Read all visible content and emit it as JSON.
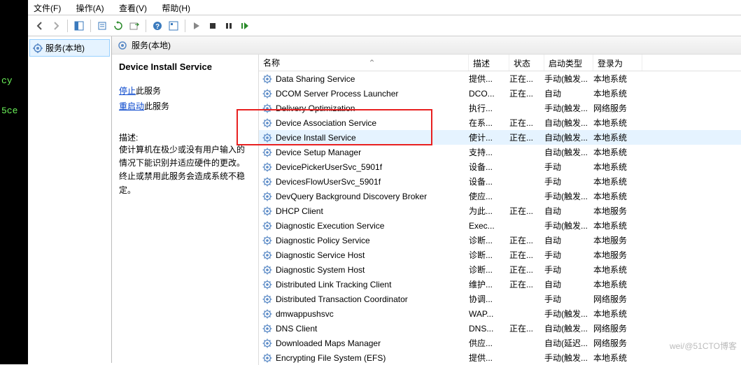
{
  "console": {
    "line1": "cy",
    "line2": "5ce"
  },
  "menu": {
    "file": "文件(F)",
    "action": "操作(A)",
    "view": "查看(V)",
    "help": "帮助(H)"
  },
  "tree": {
    "root": "服务(本地)"
  },
  "header": {
    "title": "服务(本地)"
  },
  "detail": {
    "service_name": "Device Install Service",
    "stop_link": "停止",
    "stop_suffix": "此服务",
    "restart_link": "重启动",
    "restart_suffix": "此服务",
    "desc_label": "描述:",
    "desc_text": "使计算机在极少或没有用户输入的情况下能识别并适应硬件的更改。终止或禁用此服务会造成系统不稳定。"
  },
  "columns": {
    "name": "名称",
    "desc": "描述",
    "status": "状态",
    "start": "启动类型",
    "logon": "登录为"
  },
  "rows": [
    {
      "name": "Data Sharing Service",
      "desc": "提供...",
      "status": "正在...",
      "start": "手动(触发...",
      "logon": "本地系统"
    },
    {
      "name": "DCOM Server Process Launcher",
      "desc": "DCO...",
      "status": "正在...",
      "start": "自动",
      "logon": "本地系统"
    },
    {
      "name": "Delivery Optimization",
      "desc": "执行...",
      "status": "",
      "start": "手动(触发...",
      "logon": "网络服务"
    },
    {
      "name": "Device Association Service",
      "desc": "在系...",
      "status": "正在...",
      "start": "自动(触发...",
      "logon": "本地系统"
    },
    {
      "name": "Device Install Service",
      "desc": "使计...",
      "status": "正在...",
      "start": "自动(触发...",
      "logon": "本地系统",
      "selected": true
    },
    {
      "name": "Device Setup Manager",
      "desc": "支持...",
      "status": "",
      "start": "自动(触发...",
      "logon": "本地系统"
    },
    {
      "name": "DevicePickerUserSvc_5901f",
      "desc": "设备...",
      "status": "",
      "start": "手动",
      "logon": "本地系统"
    },
    {
      "name": "DevicesFlowUserSvc_5901f",
      "desc": "设备...",
      "status": "",
      "start": "手动",
      "logon": "本地系统"
    },
    {
      "name": "DevQuery Background Discovery Broker",
      "desc": "使应...",
      "status": "",
      "start": "手动(触发...",
      "logon": "本地系统"
    },
    {
      "name": "DHCP Client",
      "desc": "为此...",
      "status": "正在...",
      "start": "自动",
      "logon": "本地服务"
    },
    {
      "name": "Diagnostic Execution Service",
      "desc": "Exec...",
      "status": "",
      "start": "手动(触发...",
      "logon": "本地系统"
    },
    {
      "name": "Diagnostic Policy Service",
      "desc": "诊断...",
      "status": "正在...",
      "start": "自动",
      "logon": "本地服务"
    },
    {
      "name": "Diagnostic Service Host",
      "desc": "诊断...",
      "status": "正在...",
      "start": "手动",
      "logon": "本地服务"
    },
    {
      "name": "Diagnostic System Host",
      "desc": "诊断...",
      "status": "正在...",
      "start": "手动",
      "logon": "本地系统"
    },
    {
      "name": "Distributed Link Tracking Client",
      "desc": "维护...",
      "status": "正在...",
      "start": "自动",
      "logon": "本地系统"
    },
    {
      "name": "Distributed Transaction Coordinator",
      "desc": "协调...",
      "status": "",
      "start": "手动",
      "logon": "网络服务"
    },
    {
      "name": "dmwappushsvc",
      "desc": "WAP...",
      "status": "",
      "start": "手动(触发...",
      "logon": "本地系统"
    },
    {
      "name": "DNS Client",
      "desc": "DNS...",
      "status": "正在...",
      "start": "自动(触发...",
      "logon": "网络服务"
    },
    {
      "name": "Downloaded Maps Manager",
      "desc": "供应...",
      "status": "",
      "start": "自动(延迟...",
      "logon": "网络服务"
    },
    {
      "name": "Encrypting File System (EFS)",
      "desc": "提供...",
      "status": "",
      "start": "手动(触发...",
      "logon": "本地系统"
    }
  ],
  "watermark": {
    "l1": "wei/@51CTO博客",
    "l2": ""
  }
}
